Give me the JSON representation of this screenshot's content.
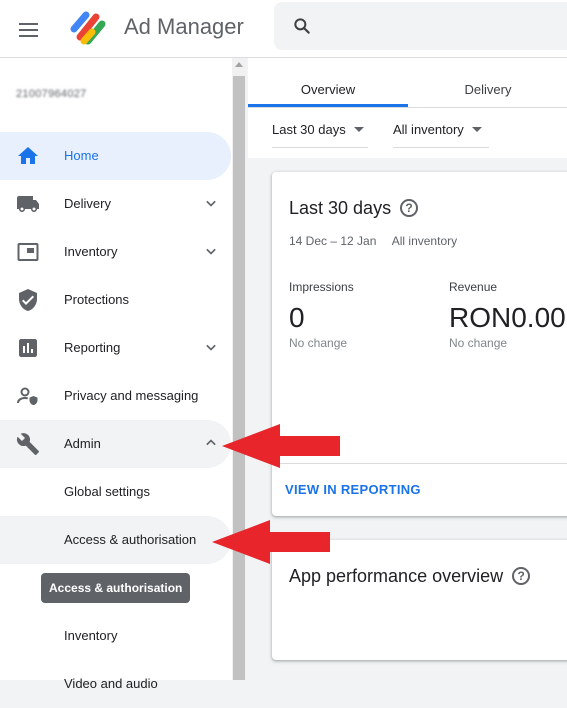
{
  "header": {
    "app_title": "Ad Manager",
    "search_icon": "search-icon",
    "menu_icon": "hamburger-menu-icon"
  },
  "sidebar": {
    "network_id": "21007964027",
    "items": [
      {
        "label": "Home",
        "icon": "home-icon",
        "active": true
      },
      {
        "label": "Delivery",
        "icon": "truck-icon",
        "expandable": true
      },
      {
        "label": "Inventory",
        "icon": "inventory-icon",
        "expandable": true
      },
      {
        "label": "Protections",
        "icon": "shield-icon"
      },
      {
        "label": "Reporting",
        "icon": "bar-chart-icon",
        "expandable": true
      },
      {
        "label": "Privacy and messaging",
        "icon": "person-shield-icon"
      },
      {
        "label": "Admin",
        "icon": "wrench-icon",
        "expandable": true,
        "expanded": true
      }
    ],
    "admin_children": [
      "Global settings",
      "Access & authorisation",
      "Inventory",
      "Video and audio"
    ],
    "tooltip": "Access & authorisation"
  },
  "tabs": [
    {
      "label": "Overview",
      "active": true
    },
    {
      "label": "Delivery"
    }
  ],
  "filters": {
    "date_range": "Last 30 days",
    "inventory": "All inventory"
  },
  "card": {
    "title": "Last 30 days",
    "date_span": "14 Dec – 12 Jan",
    "inventory": "All inventory",
    "metrics": [
      {
        "label": "Impressions",
        "value": "0",
        "change": "No change"
      },
      {
        "label": "Revenue",
        "value": "RON0.00",
        "change": "No change"
      }
    ],
    "link": "VIEW IN REPORTING"
  },
  "card2": {
    "title": "App performance overview"
  },
  "colors": {
    "accent": "#1a73e8",
    "active_nav_bg": "#e8f0fe",
    "hover_nav_bg": "#f1f3f4",
    "arrow": "#e8252b"
  }
}
